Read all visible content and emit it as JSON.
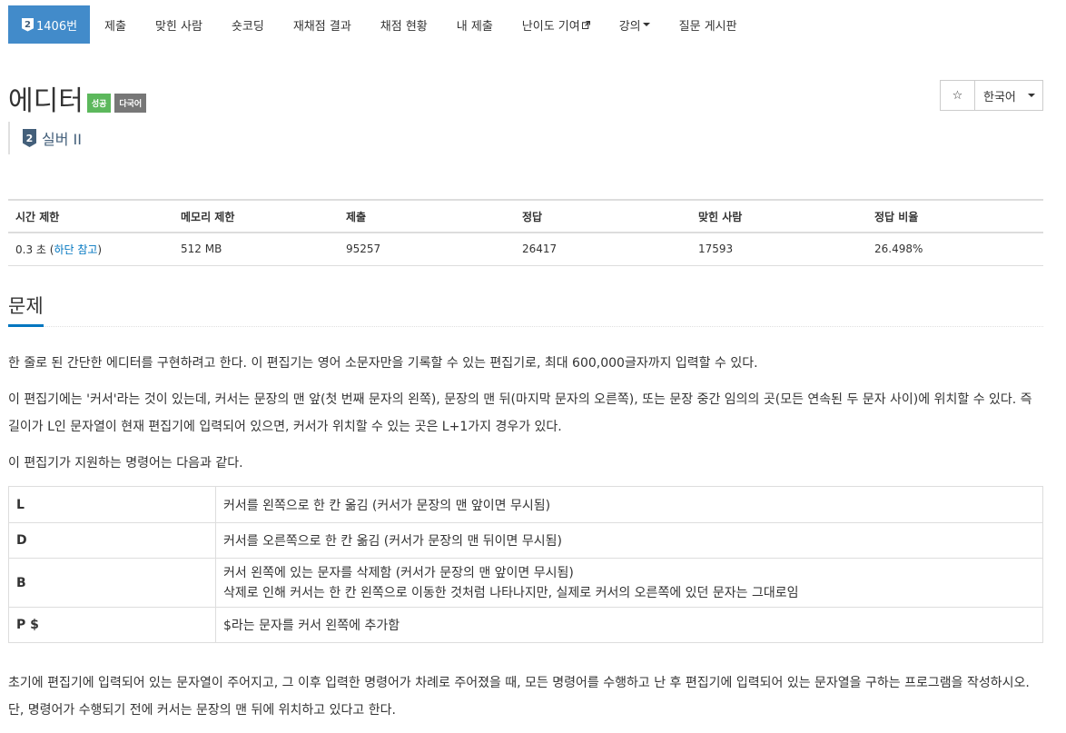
{
  "tabs": [
    {
      "label": "1406번",
      "badge": "2",
      "active": true
    },
    {
      "label": "제출"
    },
    {
      "label": "맞힌 사람"
    },
    {
      "label": "숏코딩"
    },
    {
      "label": "재채점 결과"
    },
    {
      "label": "채점 현황"
    },
    {
      "label": "내 제출"
    },
    {
      "label": "난이도 기여",
      "icon": "external-link-icon"
    },
    {
      "label": "강의",
      "icon": "caret-down-icon"
    },
    {
      "label": "질문 게시판"
    }
  ],
  "problem": {
    "title": "에디터",
    "labels": [
      "성공",
      "다국어"
    ],
    "tier_badge": "2",
    "tier": "실버 II"
  },
  "actions": {
    "star": "☆",
    "language": "한국어"
  },
  "info": {
    "headers": [
      "시간 제한",
      "메모리 제한",
      "제출",
      "정답",
      "맞힌 사람",
      "정답 비율"
    ],
    "time_value": "0.3 초 (",
    "time_link": "하단 참고",
    "time_close": ")",
    "memory": "512 MB",
    "submissions": "95257",
    "accepted": "26417",
    "solvers": "17593",
    "ratio": "26.498%"
  },
  "section_title": "문제",
  "paragraphs": [
    "한 줄로 된 간단한 에디터를 구현하려고 한다. 이 편집기는 영어 소문자만을 기록할 수 있는 편집기로, 최대 600,000글자까지 입력할 수 있다.",
    "이 편집기에는 '커서'라는 것이 있는데, 커서는 문장의 맨 앞(첫 번째 문자의 왼쪽), 문장의 맨 뒤(마지막 문자의 오른쪽), 또는 문장 중간 임의의 곳(모든 연속된 두 문자 사이)에 위치할 수 있다. 즉 길이가 L인 문자열이 현재 편집기에 입력되어 있으면, 커서가 위치할 수 있는 곳은 L+1가지 경우가 있다.",
    "이 편집기가 지원하는 명령어는 다음과 같다.",
    "초기에 편집기에 입력되어 있는 문자열이 주어지고, 그 이후 입력한 명령어가 차례로 주어졌을 때, 모든 명령어를 수행하고 난 후 편집기에 입력되어 있는 문자열을 구하는 프로그램을 작성하시오. 단, 명령어가 수행되기 전에 커서는 문장의 맨 뒤에 위치하고 있다고 한다."
  ],
  "commands": [
    {
      "key": "L",
      "desc": [
        "커서를 왼쪽으로 한 칸 옮김 (커서가 문장의 맨 앞이면 무시됨)"
      ]
    },
    {
      "key": "D",
      "desc": [
        "커서를 오른쪽으로 한 칸 옮김 (커서가 문장의 맨 뒤이면 무시됨)"
      ]
    },
    {
      "key": "B",
      "desc": [
        "커서 왼쪽에 있는 문자를 삭제함 (커서가 문장의 맨 앞이면 무시됨)",
        "삭제로 인해 커서는 한 칸 왼쪽으로 이동한 것처럼 나타나지만, 실제로 커서의 오른쪽에 있던 문자는 그대로임"
      ]
    },
    {
      "key": "P $",
      "desc": [
        "$라는 문자를 커서 왼쪽에 추가함"
      ]
    }
  ],
  "colors": {
    "accent": "#428bca",
    "link": "#0076c0",
    "success": "#5cb85c",
    "default_label": "#777777",
    "tier": "#435f7a"
  }
}
